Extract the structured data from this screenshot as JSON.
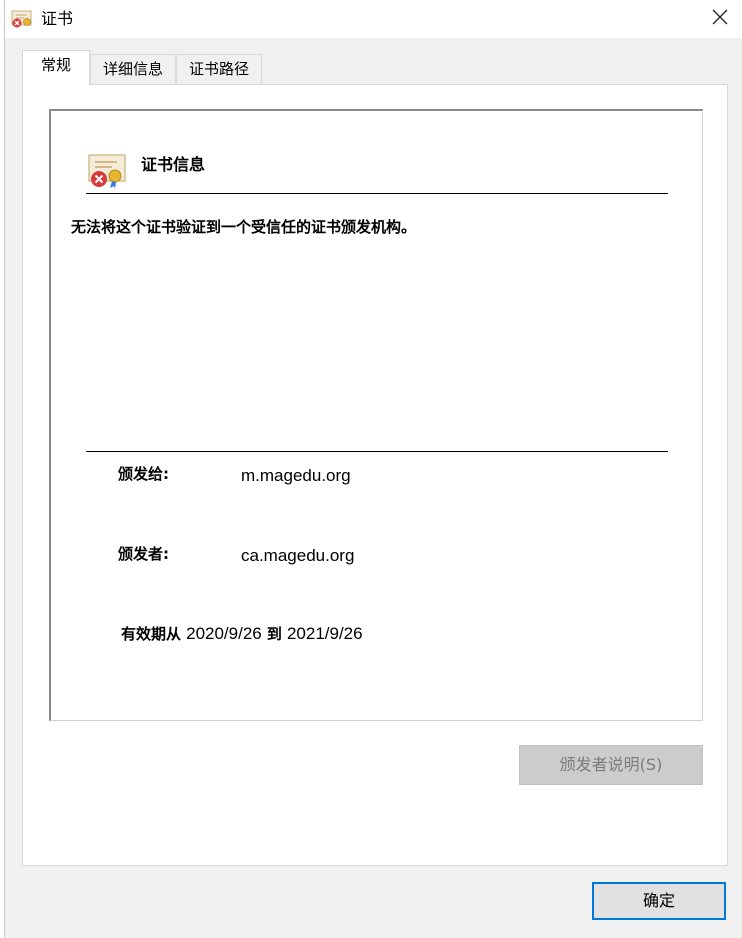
{
  "window": {
    "title": "证书",
    "title_icon": "certificate-error-icon",
    "close_icon": "close-icon"
  },
  "tabs": [
    {
      "label": "常规",
      "active": true
    },
    {
      "label": "详细信息",
      "active": false
    },
    {
      "label": "证书路径",
      "active": false
    }
  ],
  "general": {
    "heading": "证书信息",
    "heading_icon": "certificate-error-icon",
    "warning": "无法将这个证书验证到一个受信任的证书颁发机构。",
    "issued_to_label": "颁发给:",
    "issued_to_value": "m.magedu.org",
    "issued_by_label": "颁发者:",
    "issued_by_value": "ca.magedu.org",
    "valid_from_label": "有效期从",
    "valid_from_value": "2020/9/26",
    "valid_to_label": "到",
    "valid_to_value": "2021/9/26",
    "issuer_statement_button": "颁发者说明(S)"
  },
  "footer": {
    "ok_button": "确定"
  },
  "colors": {
    "accent_border": "#0078d7",
    "disabled_button_bg": "#cccccc",
    "disabled_button_text": "#7c7c7c"
  }
}
